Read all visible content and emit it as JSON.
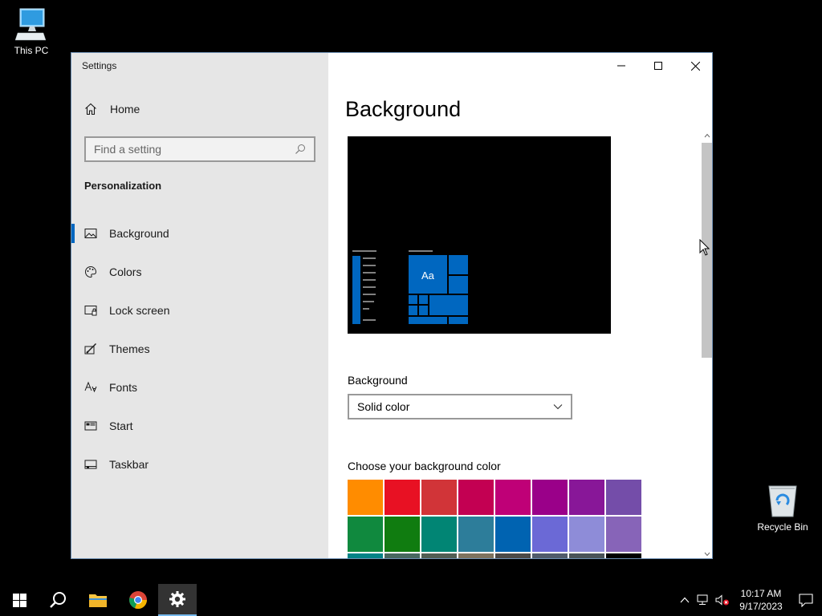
{
  "desktop": {
    "this_pc_label": "This PC",
    "recycle_bin_label": "Recycle Bin"
  },
  "window": {
    "title": "Settings",
    "home_label": "Home",
    "search_placeholder": "Find a setting",
    "section_label": "Personalization",
    "nav_items": [
      {
        "label": "Background",
        "icon": "image-icon",
        "active": true
      },
      {
        "label": "Colors",
        "icon": "palette-icon",
        "active": false
      },
      {
        "label": "Lock screen",
        "icon": "lock-screen-icon",
        "active": false
      },
      {
        "label": "Themes",
        "icon": "themes-icon",
        "active": false
      },
      {
        "label": "Fonts",
        "icon": "fonts-icon",
        "active": false
      },
      {
        "label": "Start",
        "icon": "start-icon",
        "active": false
      },
      {
        "label": "Taskbar",
        "icon": "taskbar-icon",
        "active": false
      }
    ],
    "accent_color": "#0067c0"
  },
  "content": {
    "page_title": "Background",
    "preview_tile_text": "Aa",
    "background_label": "Background",
    "background_value": "Solid color",
    "choose_color_label": "Choose your background color",
    "swatches": [
      "#ff8c00",
      "#e81123",
      "#d13438",
      "#c30052",
      "#bf0077",
      "#9a0089",
      "#881798",
      "#744da9",
      "#10893e",
      "#107c10",
      "#018574",
      "#2d7d9a",
      "#0063b1",
      "#6b69d6",
      "#8e8cd8",
      "#8764b8",
      "#038387",
      "#486860",
      "#525e54",
      "#7e735f",
      "#4c4a48",
      "#515c6b",
      "#4a5459",
      "#000000"
    ]
  },
  "taskbar": {
    "time": "10:17 AM",
    "date": "9/17/2023"
  }
}
